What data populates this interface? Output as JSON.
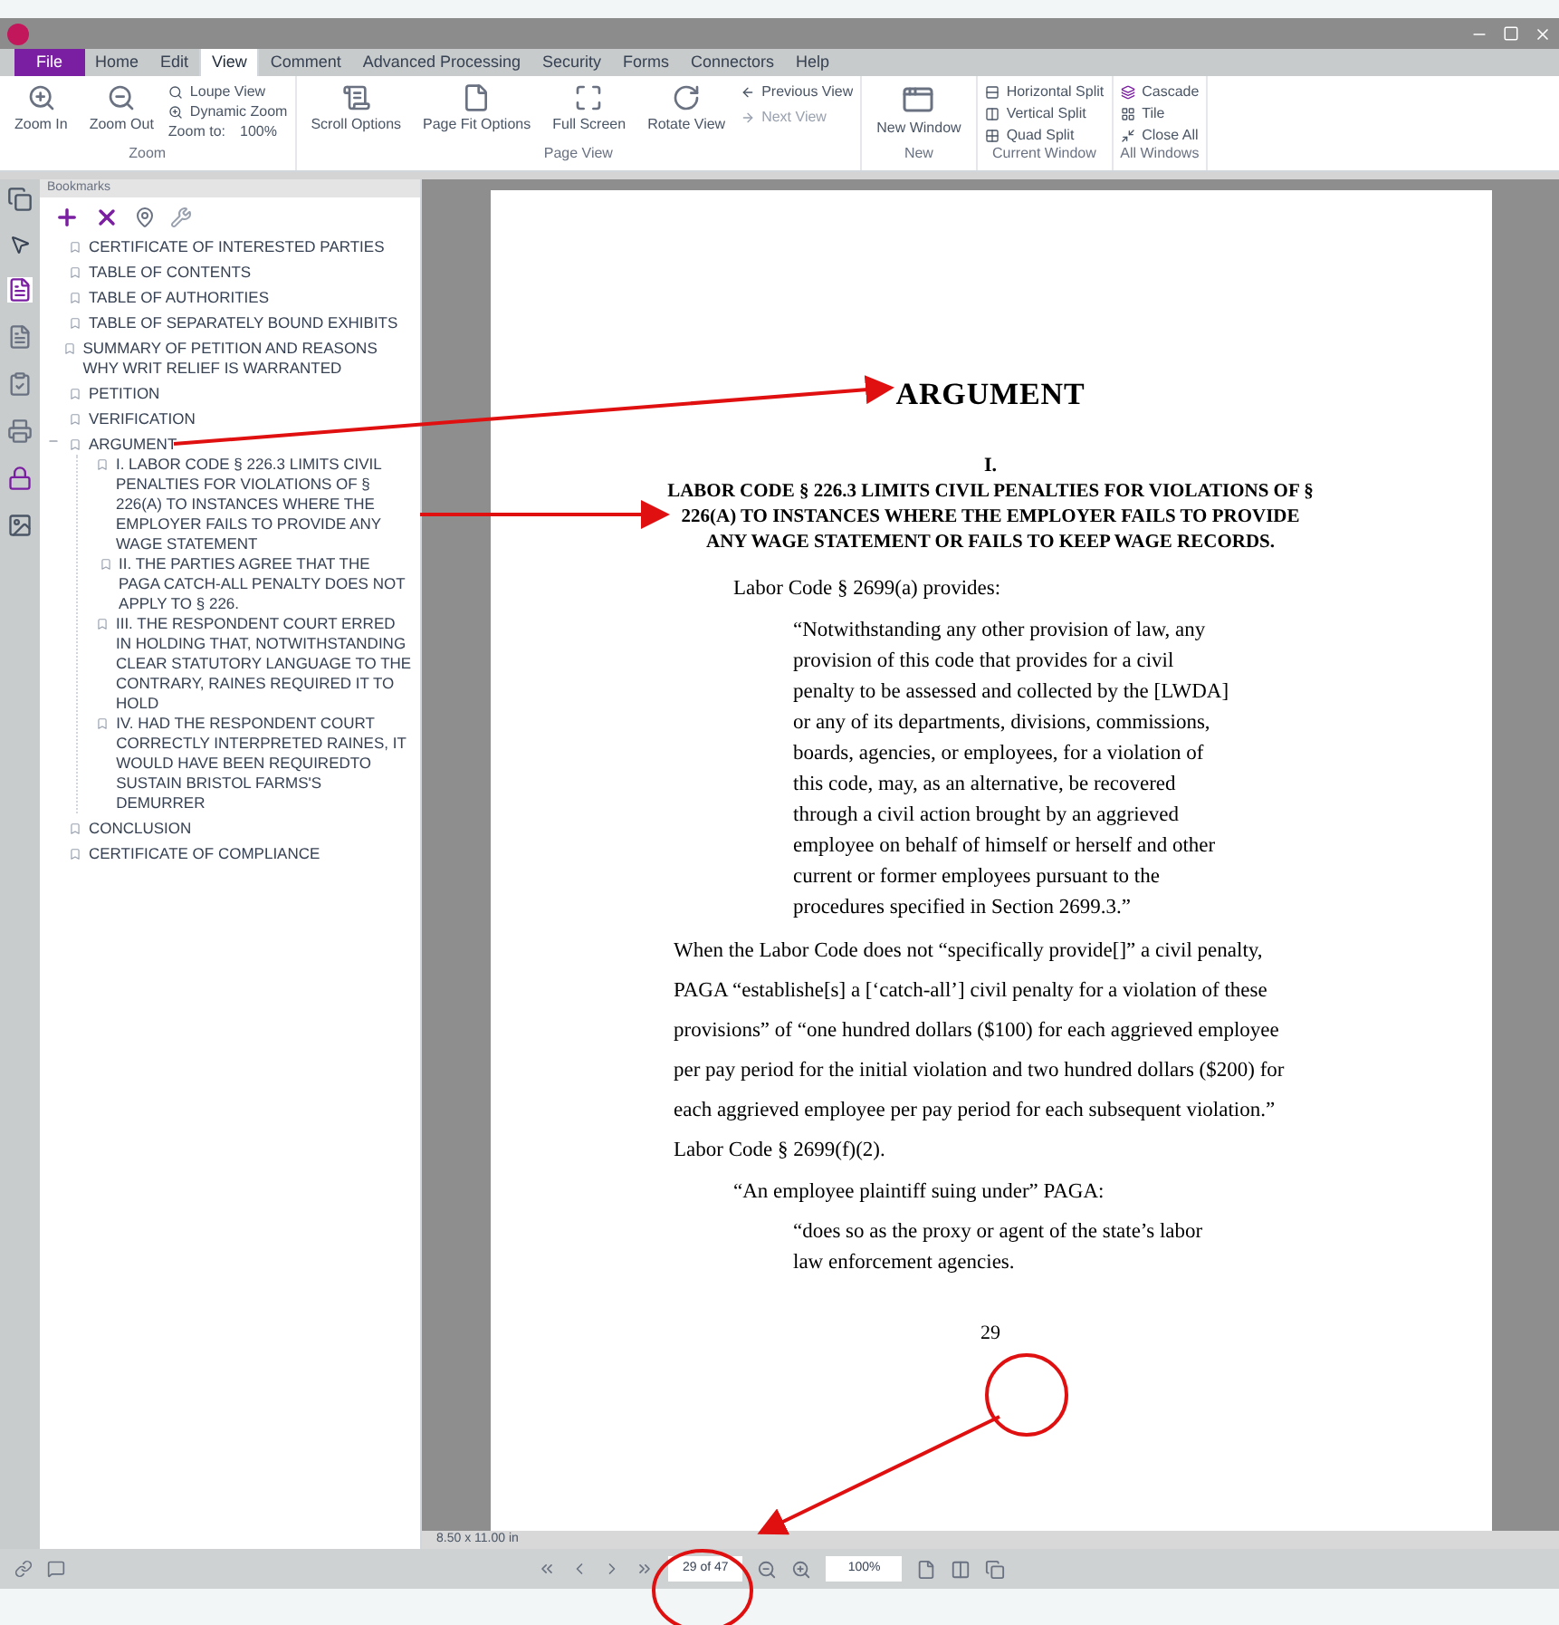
{
  "menu": [
    {
      "label": "File",
      "kind": "file",
      "selected": false
    },
    {
      "label": "Home",
      "kind": "tab",
      "selected": false
    },
    {
      "label": "Edit",
      "kind": "tab",
      "selected": false
    },
    {
      "label": "View",
      "kind": "tab",
      "selected": true
    },
    {
      "label": "Comment",
      "kind": "tab",
      "selected": false
    },
    {
      "label": "Advanced Processing",
      "kind": "tab",
      "selected": false
    },
    {
      "label": "Security",
      "kind": "tab",
      "selected": false
    },
    {
      "label": "Forms",
      "kind": "tab",
      "selected": false
    },
    {
      "label": "Connectors",
      "kind": "tab",
      "selected": false
    },
    {
      "label": "Help",
      "kind": "tab",
      "selected": false
    }
  ],
  "ribbon": {
    "zoom": {
      "label": "Zoom",
      "zoom_in": "Zoom In",
      "zoom_out": "Zoom Out",
      "loupe": "Loupe View",
      "dynamic": "Dynamic Zoom",
      "zoom_to": "Zoom to:",
      "zoom_value": "100%"
    },
    "page_view": {
      "label": "Page View",
      "scroll": "Scroll Options",
      "fit": "Page Fit Options",
      "full": "Full Screen",
      "rotate": "Rotate View",
      "previous": "Previous View",
      "next": "Next View"
    },
    "new": {
      "label": "New",
      "new_window": "New Window"
    },
    "current_window": {
      "label": "Current Window",
      "items": [
        "Horizontal Split",
        "Vertical Split",
        "Quad Split"
      ]
    },
    "all_windows": {
      "label": "All Windows",
      "items": [
        "Cascade",
        "Tile",
        "Close All"
      ]
    }
  },
  "bookmarks": {
    "title": "Bookmarks",
    "items": [
      {
        "label": "CERTIFICATE OF INTERESTED PARTIES"
      },
      {
        "label": "TABLE OF CONTENTS"
      },
      {
        "label": "TABLE OF AUTHORITIES"
      },
      {
        "label": "TABLE OF SEPARATELY BOUND EXHIBITS"
      },
      {
        "label": "SUMMARY OF PETITION AND  REASONS WHY WRIT RELIEF IS WARRANTED"
      },
      {
        "label": "PETITION"
      },
      {
        "label": "VERIFICATION"
      },
      {
        "label": "ARGUMENT",
        "expanded": true,
        "children": [
          {
            "label": "I.  LABOR CODE § 226.3 LIMITS CIVIL PENALTIES FOR VIOLATIONS OF § 226(A) TO INSTANCES WHERE THE EMPLOYER FAILS TO PROVIDE  ANY WAGE STATEMENT"
          },
          {
            "label": "II.  THE PARTIES AGREE THAT THE PAGA CATCH-ALL PENALTY DOES  NOT APPLY TO § 226."
          },
          {
            "label": "III.  THE RESPONDENT COURT ERRED IN HOLDING THAT,  NOTWITHSTANDING CLEAR STATUTORY LANGUAGE TO THE CONTRARY, RAINES REQUIRED IT TO HOLD"
          },
          {
            "label": "IV.  HAD THE RESPONDENT COURT CORRECTLY INTERPRETED RAINES,  IT WOULD HAVE BEEN REQUIREDTO SUSTAIN BRISTOL FARMS'S  DEMURRER"
          }
        ]
      },
      {
        "label": "CONCLUSION"
      },
      {
        "label": "CERTIFICATE OF COMPLIANCE"
      }
    ]
  },
  "page": {
    "heading": "ARGUMENT",
    "section_number": "I.",
    "section_title": "LABOR CODE § 226.3 LIMITS CIVIL PENALTIES FOR VIOLATIONS OF § 226(A) TO INSTANCES WHERE THE EMPLOYER FAILS TO PROVIDE ANY WAGE STATEMENT OR FAILS TO KEEP WAGE RECORDS.",
    "intro": "Labor Code § 2699(a) provides:",
    "quote": "“Notwithstanding any other provision of law, any provision of this code that provides for a civil penalty to be assessed and collected by the [LWDA] or any of its departments, divisions, commissions, boards, agencies, or employees, for a violation of this code, may, as an alternative, be recovered through a civil action brought by an aggrieved employee on behalf of himself or herself and other current or former employees pursuant to the procedures specified in Section 2699.3.”",
    "body": "When the Labor Code does not “specifically provide[]” a civil penalty, PAGA “establishe[s] a [‘catch-all’] civil penalty for a violation of these provisions” of “one hundred dollars ($100) for each aggrieved employee per pay period for the initial violation and two hundred dollars ($200) for each aggrieved employee per pay period for each subsequent violation.”  Labor Code § 2699(f)(2).",
    "lead": "“An employee plaintiff suing under” PAGA:",
    "quote2": "“does so as the proxy or agent of the state’s labor law enforcement agencies.",
    "page_number": "29"
  },
  "page_size": "8.50 x 11.00 in",
  "status": {
    "page_field": "29 of 47",
    "zoom": "100%"
  }
}
